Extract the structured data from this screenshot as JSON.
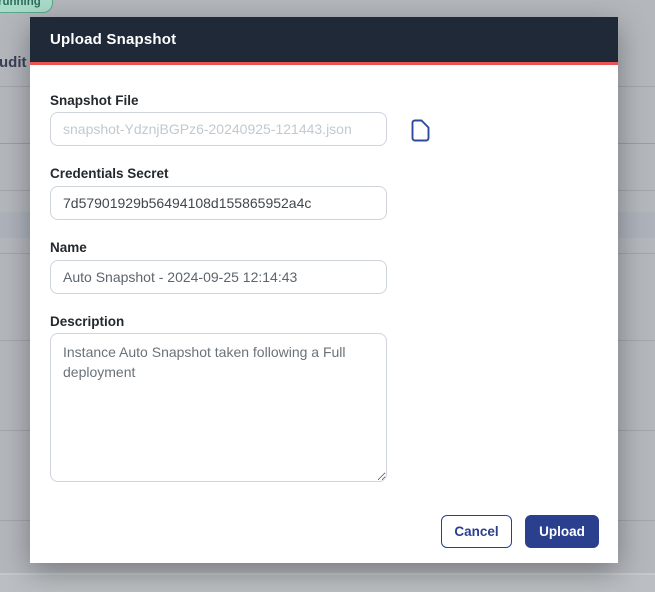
{
  "background": {
    "status_badge": "running",
    "page_text": "udit L"
  },
  "dialog": {
    "title": "Upload Snapshot",
    "fields": {
      "snapshot_file": {
        "label": "Snapshot File",
        "placeholder": "snapshot-YdznjBGPz6-20240925-121443.json"
      },
      "credentials_secret": {
        "label": "Credentials Secret",
        "value": "7d57901929b56494108d155865952a4c"
      },
      "name": {
        "label": "Name",
        "value": "Auto Snapshot - 2024-09-25 12:14:43"
      },
      "description": {
        "label": "Description",
        "value": "Instance Auto Snapshot taken following a Full deployment"
      }
    },
    "buttons": {
      "cancel": "Cancel",
      "upload": "Upload"
    },
    "colors": {
      "header_bg": "#1f2937",
      "accent_line": "#e95555",
      "primary_blue": "#2a3f8d",
      "badge_green": "#5aa98d"
    },
    "icons": {
      "file_icon": "file-icon"
    }
  }
}
